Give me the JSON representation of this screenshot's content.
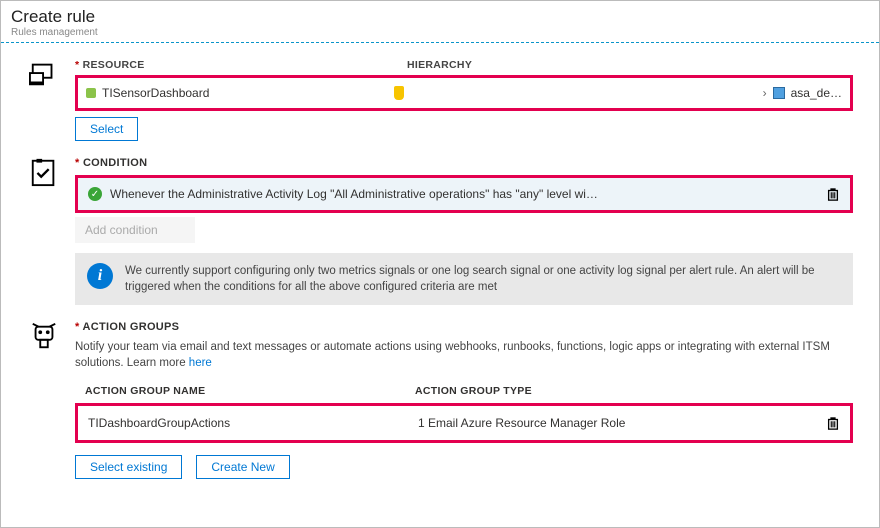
{
  "header": {
    "title": "Create rule",
    "subtitle": "Rules management"
  },
  "resource": {
    "section_label": "RESOURCE",
    "hierarchy_label": "HIERARCHY",
    "name": "TISensorDashboard",
    "hierarchy_item": "asa_de…",
    "select_button": "Select"
  },
  "condition": {
    "section_label": "CONDITION",
    "text": "Whenever the Administrative Activity Log \"All Administrative operations\" has \"any\" level wi…",
    "add_button": "Add condition",
    "info_text": "We currently support configuring only two metrics signals or one log search signal or one activity log signal per alert rule. An alert will be triggered when the conditions for all the above configured criteria are met"
  },
  "action_groups": {
    "section_label": "ACTION GROUPS",
    "description": "Notify your team via email and text messages or automate actions using webhooks, runbooks, functions, logic apps or integrating with external ITSM solutions. Learn more ",
    "learn_more": "here",
    "col_name": "ACTION GROUP NAME",
    "col_type": "ACTION GROUP TYPE",
    "row_name": "TIDashboardGroupActions",
    "row_type": "1 Email Azure Resource Manager Role",
    "select_existing": "Select existing",
    "create_new": "Create New"
  }
}
